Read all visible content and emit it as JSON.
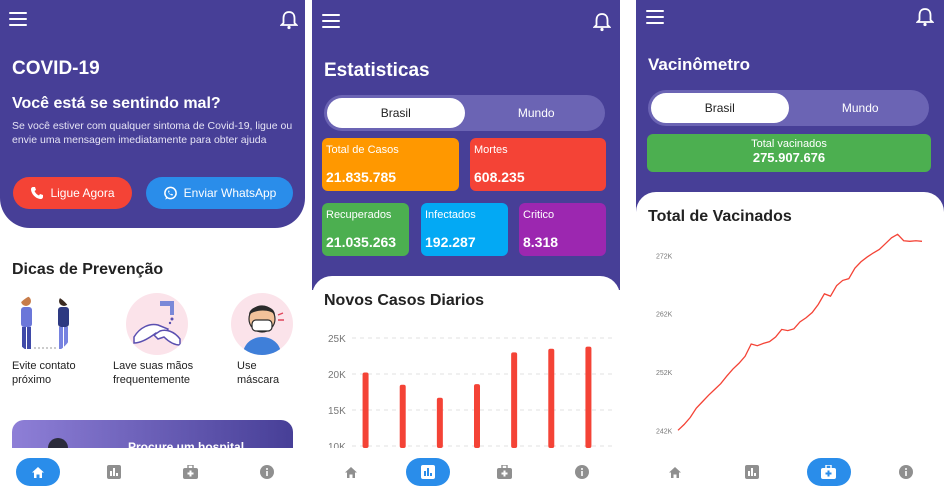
{
  "screen1": {
    "title": "COVID-19",
    "subtitle": "Você está se sentindo mal?",
    "description": "Se você estiver com qualquer sintoma de Covid-19, ligue ou envie uma mensagem imediatamente para obter ajuda",
    "call_button": "Ligue Agora",
    "whatsapp_button": "Enviar WhatsApp",
    "prevention_title": "Dicas de Prevenção",
    "tips": [
      {
        "label": "Evite contato próximo"
      },
      {
        "label": "Lave suas mãos frequentemente"
      },
      {
        "label": "Use máscara"
      }
    ],
    "banner_text": "Procure um hospital"
  },
  "screen2": {
    "title": "Estatisticas",
    "toggle": {
      "brasil": "Brasil",
      "mundo": "Mundo"
    },
    "stats": {
      "total": {
        "label": "Total de Casos",
        "value": "21.835.785",
        "color": "#ff9800"
      },
      "mortes": {
        "label": "Mortes",
        "value": "608.235",
        "color": "#f44336"
      },
      "recuperados": {
        "label": "Recuperados",
        "value": "21.035.263",
        "color": "#4caf50"
      },
      "infectados": {
        "label": "Infectados",
        "value": "192.287",
        "color": "#03a9f4"
      },
      "critico": {
        "label": "Critico",
        "value": "8.318",
        "color": "#9c27b0"
      }
    },
    "chart_title": "Novos Casos Diarios"
  },
  "screen3": {
    "title": "Vacinômetro",
    "toggle": {
      "brasil": "Brasil",
      "mundo": "Mundo"
    },
    "total_label": "Total vacinados",
    "total_value": "275.907.676",
    "chart_title": "Total de Vacinados"
  },
  "chart_data": [
    {
      "type": "bar",
      "title": "Novos Casos Diarios",
      "y_tick_labels": [
        "25K",
        "20K",
        "15K",
        "10K"
      ],
      "ylim": [
        10000,
        25000
      ],
      "values": [
        20200,
        18500,
        16700,
        18600,
        23000,
        23500,
        23800
      ],
      "color": "#f44336",
      "grid": true
    },
    {
      "type": "line",
      "title": "Total de Vacinados",
      "y_tick_labels": [
        "272K",
        "262K",
        "252K",
        "242K"
      ],
      "ylim": [
        240000,
        276000
      ],
      "values": [
        242000,
        243000,
        244200,
        245800,
        246900,
        248000,
        249000,
        250000,
        251300,
        252500,
        253500,
        254700,
        256800,
        256500,
        256900,
        257200,
        258000,
        259300,
        259100,
        259400,
        260600,
        261300,
        262200,
        263600,
        265400,
        265000,
        266800,
        267700,
        268000,
        269800,
        270900,
        271700,
        272400,
        273000,
        274000,
        275000,
        275600,
        274500,
        274400,
        274500,
        274400
      ],
      "color": "#f44336",
      "grid": false
    }
  ],
  "colors": {
    "purple": "#473f97",
    "accent_blue": "#2a8dea",
    "red": "#f44336",
    "green_btn": "#2a8dea"
  }
}
